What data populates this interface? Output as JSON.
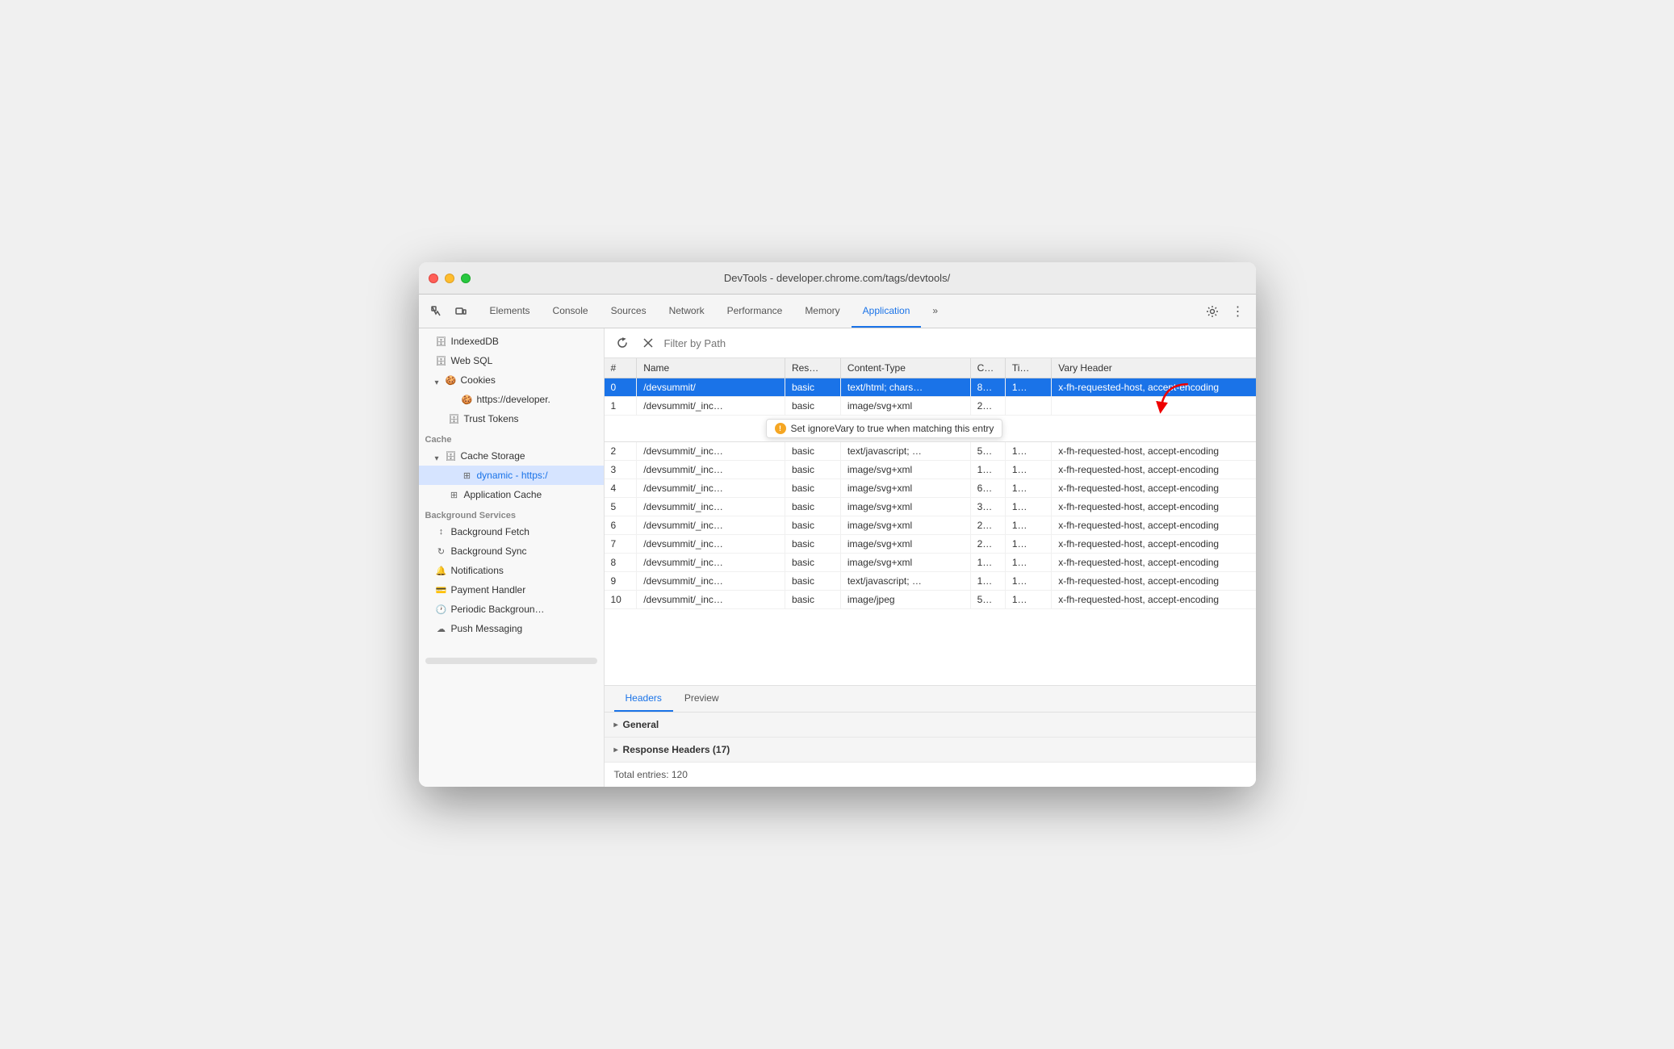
{
  "titlebar": {
    "title": "DevTools - developer.chrome.com/tags/devtools/"
  },
  "toolbar": {
    "tabs": [
      {
        "id": "elements",
        "label": "Elements",
        "active": false
      },
      {
        "id": "console",
        "label": "Console",
        "active": false
      },
      {
        "id": "sources",
        "label": "Sources",
        "active": false
      },
      {
        "id": "network",
        "label": "Network",
        "active": false
      },
      {
        "id": "performance",
        "label": "Performance",
        "active": false
      },
      {
        "id": "memory",
        "label": "Memory",
        "active": false
      },
      {
        "id": "application",
        "label": "Application",
        "active": true
      }
    ],
    "more_label": "»"
  },
  "sidebar": {
    "indexeddb": "IndexedDB",
    "websql": "Web SQL",
    "cookies_section": "Cookies",
    "cookies_url": "https://developer.",
    "trust_tokens": "Trust Tokens",
    "cache_section": "Cache",
    "cache_storage": "Cache Storage",
    "dynamic_entry": "dynamic - https:/",
    "application_cache": "Application Cache",
    "background_services": "Background Services",
    "background_fetch": "Background Fetch",
    "background_sync": "Background Sync",
    "notifications": "Notifications",
    "payment_handler": "Payment Handler",
    "periodic_background": "Periodic Backgroun…",
    "push_messaging": "Push Messaging"
  },
  "filter": {
    "placeholder": "Filter by Path"
  },
  "table": {
    "columns": [
      "#",
      "Name",
      "Res…",
      "Content-Type",
      "C…",
      "Ti…",
      "Vary Header"
    ],
    "rows": [
      {
        "num": "0",
        "name": "/devsummit/",
        "res": "basic",
        "content": "text/html; chars…",
        "c": "8…",
        "ti": "1…",
        "vary": "x-fh-requested-host, accept-encoding",
        "selected": true
      },
      {
        "num": "1",
        "name": "/devsummit/_inc…",
        "res": "basic",
        "content": "image/svg+xml",
        "c": "2…",
        "ti": "",
        "vary": "",
        "tooltip": true
      },
      {
        "num": "2",
        "name": "/devsummit/_inc…",
        "res": "basic",
        "content": "text/javascript; …",
        "c": "5…",
        "ti": "1…",
        "vary": "x-fh-requested-host, accept-encoding"
      },
      {
        "num": "3",
        "name": "/devsummit/_inc…",
        "res": "basic",
        "content": "image/svg+xml",
        "c": "1…",
        "ti": "1…",
        "vary": "x-fh-requested-host, accept-encoding"
      },
      {
        "num": "4",
        "name": "/devsummit/_inc…",
        "res": "basic",
        "content": "image/svg+xml",
        "c": "6…",
        "ti": "1…",
        "vary": "x-fh-requested-host, accept-encoding"
      },
      {
        "num": "5",
        "name": "/devsummit/_inc…",
        "res": "basic",
        "content": "image/svg+xml",
        "c": "3…",
        "ti": "1…",
        "vary": "x-fh-requested-host, accept-encoding"
      },
      {
        "num": "6",
        "name": "/devsummit/_inc…",
        "res": "basic",
        "content": "image/svg+xml",
        "c": "2…",
        "ti": "1…",
        "vary": "x-fh-requested-host, accept-encoding"
      },
      {
        "num": "7",
        "name": "/devsummit/_inc…",
        "res": "basic",
        "content": "image/svg+xml",
        "c": "2…",
        "ti": "1…",
        "vary": "x-fh-requested-host, accept-encoding"
      },
      {
        "num": "8",
        "name": "/devsummit/_inc…",
        "res": "basic",
        "content": "image/svg+xml",
        "c": "1…",
        "ti": "1…",
        "vary": "x-fh-requested-host, accept-encoding"
      },
      {
        "num": "9",
        "name": "/devsummit/_inc…",
        "res": "basic",
        "content": "text/javascript; …",
        "c": "1…",
        "ti": "1…",
        "vary": "x-fh-requested-host, accept-encoding"
      },
      {
        "num": "10",
        "name": "/devsummit/_inc…",
        "res": "basic",
        "content": "image/jpeg",
        "c": "5…",
        "ti": "1…",
        "vary": "x-fh-requested-host, accept-encoding"
      }
    ],
    "tooltip_text": "Set ignoreVary to true when matching this entry"
  },
  "bottom": {
    "tabs": [
      "Headers",
      "Preview"
    ],
    "active_tab": "Headers",
    "general_label": "General",
    "response_headers_label": "Response Headers (17)",
    "total_entries": "Total entries: 120"
  }
}
